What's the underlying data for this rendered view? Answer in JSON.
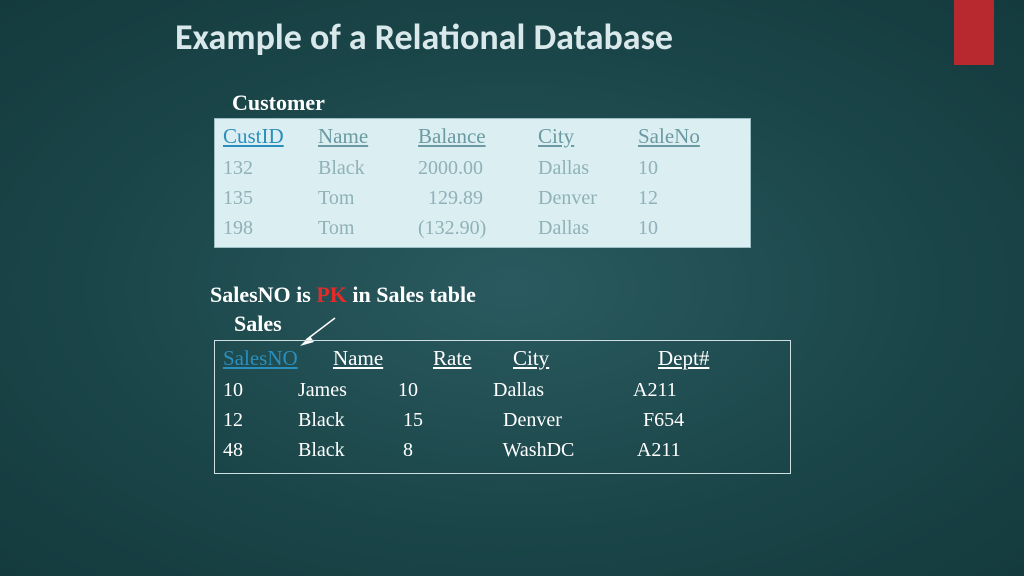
{
  "title": "Example of a Relational Database",
  "customer": {
    "label": "Customer",
    "headers": [
      "CustID",
      "Name",
      "Balance",
      "City",
      "SaleNo"
    ],
    "rows": [
      [
        "132",
        "Black",
        "2000.00",
        "Dallas",
        "10"
      ],
      [
        "135",
        "Tom",
        "  129.89",
        "Denver",
        "12"
      ],
      [
        "198",
        "Tom",
        "(132.90)",
        "Dallas",
        "10"
      ]
    ]
  },
  "note": {
    "prefix": "SalesNO  is ",
    "pk": "PK",
    "suffix": " in Sales table"
  },
  "sales": {
    "label": "Sales",
    "headers": [
      "SalesNO",
      "Name",
      "Rate",
      "City",
      "Dept#"
    ],
    "rows": [
      [
        "10",
        "James",
        "10",
        "Dallas",
        "A211"
      ],
      [
        "12",
        "Black",
        " 15",
        "  Denver",
        "  F654"
      ],
      [
        "48",
        "Black",
        " 8",
        "  WashDC",
        " A211"
      ]
    ]
  }
}
